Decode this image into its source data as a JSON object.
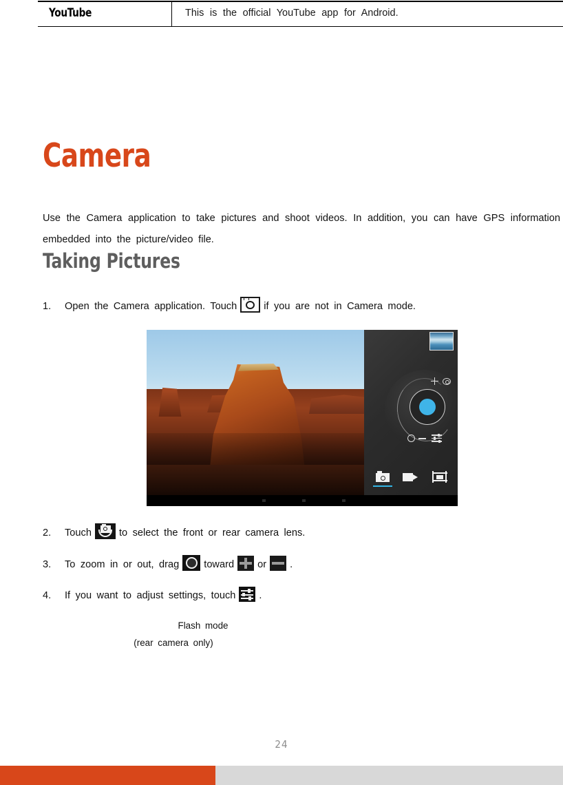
{
  "header": {
    "app_name": "YouTube",
    "app_description": "This is the official YouTube app for Android."
  },
  "chapter": {
    "title": "Camera",
    "title_color": "#d8471a",
    "intro": "Use the Camera application to take pictures and shoot videos. In addition, you can have GPS information embedded into the picture/video file."
  },
  "section": {
    "heading": "Taking Pictures",
    "heading_color": "#5e5e5e"
  },
  "steps": [
    {
      "number": "1.",
      "text_before": "Open the Camera application. Touch",
      "icon": "camera-mode-icon",
      "text_after": "if you are not in Camera mode."
    },
    {
      "number": "2.",
      "text_before": "Touch",
      "icon": "switch-camera-icon",
      "text_after": "to select the front or rear camera lens."
    },
    {
      "number": "3.",
      "text_before": "To zoom in or out, drag",
      "icon": "zoom-handle-icon",
      "text_mid": "toward",
      "icon2": "zoom-in-plus-icon",
      "text_mid2": "or",
      "icon3": "zoom-out-minus-icon",
      "text_after": "."
    },
    {
      "number": "4.",
      "text_before": "If you want to adjust settings, touch",
      "icon": "settings-sliders-icon",
      "text_after": "."
    }
  ],
  "screenshot": {
    "alt": "Android camera application screenshot",
    "thumbnail_label": "last-photo-thumbnail",
    "shutter_color": "#3fb4e8",
    "active_mode_color": "#33b5e5",
    "modes": [
      {
        "name": "photo-mode",
        "selected": true
      },
      {
        "name": "video-mode",
        "selected": false
      },
      {
        "name": "panorama-mode",
        "selected": false
      }
    ],
    "dial_markers": [
      "+",
      "−"
    ]
  },
  "callouts": {
    "flash_mode": "Flash mode",
    "flash_mode_note": "(rear camera only)"
  },
  "footer": {
    "page_number": "24",
    "accent_color": "#d8471a",
    "secondary_color": "#d8d8d8"
  }
}
